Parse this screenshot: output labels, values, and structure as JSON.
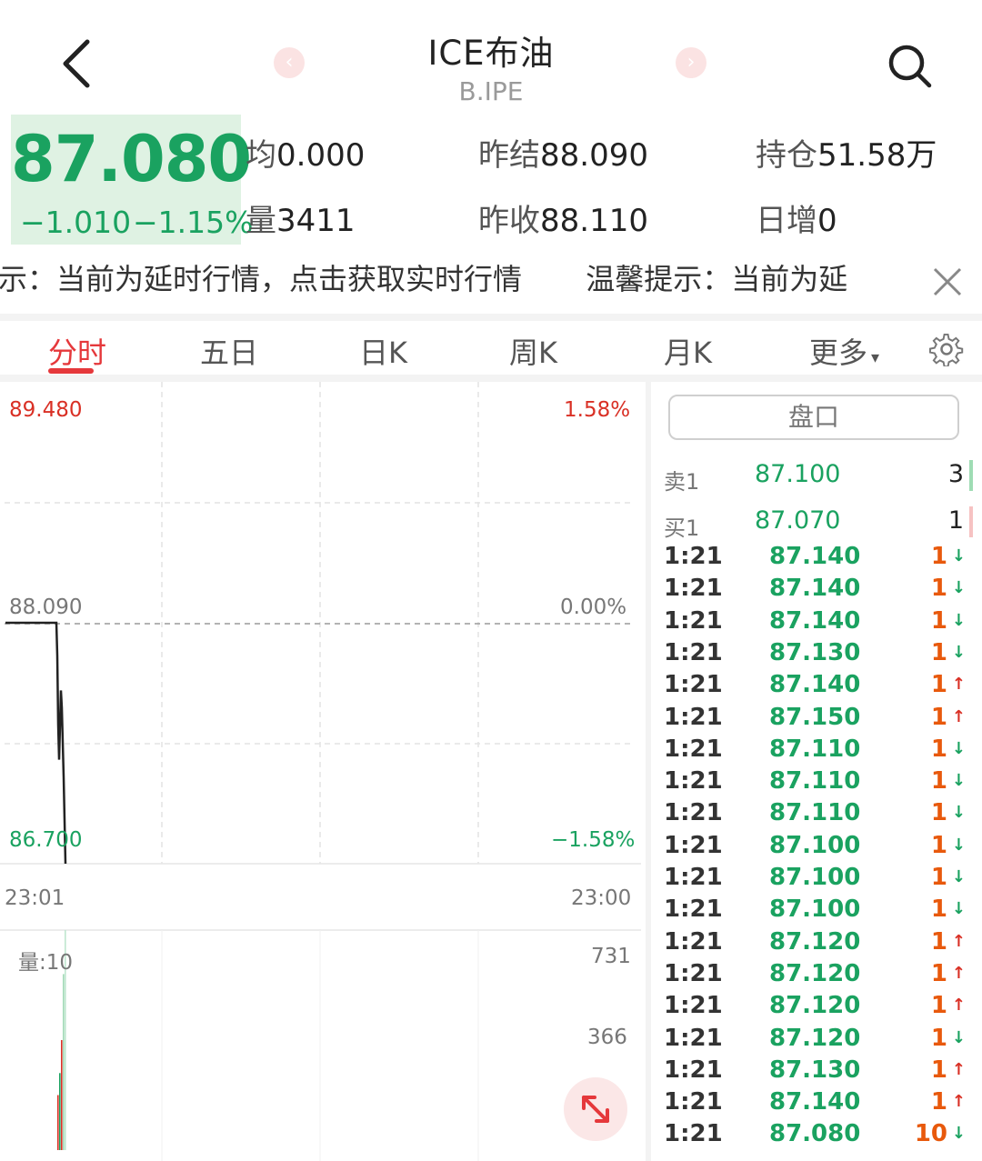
{
  "header": {
    "title": "ICE布油",
    "code": "B.IPE"
  },
  "quote": {
    "price": "87.080",
    "change": "−1.010",
    "change_pct": "−1.15%",
    "avg_label": "均",
    "avg_value": "0.000",
    "prev_settle_label": "昨结",
    "prev_settle_value": "88.090",
    "open_interest_label": "持仓",
    "open_interest_value": "51.58万",
    "volume_label": "量",
    "volume_value": "3411",
    "prev_close_label": "昨收",
    "prev_close_value": "88.110",
    "daily_increase_label": "日增",
    "daily_increase_value": "0"
  },
  "notice": {
    "text_1": "提示：当前为延时行情，点击获取实时行情",
    "text_2": "温馨提示：当前为延"
  },
  "tabs": [
    {
      "label": "分时",
      "active": true
    },
    {
      "label": "五日",
      "active": false
    },
    {
      "label": "日K",
      "active": false
    },
    {
      "label": "周K",
      "active": false
    },
    {
      "label": "月K",
      "active": false
    },
    {
      "label": "更多",
      "active": false
    }
  ],
  "chart": {
    "price_high": "89.480",
    "pct_high": "1.58%",
    "price_mid": "88.090",
    "pct_mid": "0.00%",
    "price_low": "86.700",
    "pct_low": "−1.58%",
    "time_start": "23:01",
    "time_end": "23:00",
    "volume_label": "量:10",
    "vol_max": "731",
    "vol_mid": "366"
  },
  "chart_data": {
    "type": "line",
    "title": "",
    "ylim": [
      86.7,
      89.48
    ],
    "reference_price": 88.09,
    "x_range": [
      "23:01",
      "23:00"
    ],
    "series": [
      {
        "values": [
          88.09,
          88.09,
          87.9,
          87.5,
          87.3,
          87.7,
          87.6,
          87.2,
          86.7
        ]
      }
    ],
    "volume_ylim": [
      0,
      731
    ],
    "grid": true,
    "colors": {
      "up": "#d93025",
      "down": "#1aa260",
      "line": "#222222"
    }
  },
  "orderbook": {
    "title": "盘口",
    "sell": {
      "label": "卖1",
      "price": "87.100",
      "volume": "3"
    },
    "buy": {
      "label": "买1",
      "price": "87.070",
      "volume": "1"
    }
  },
  "ticks": [
    {
      "time": "1:21",
      "price": "87.140",
      "vol": "1",
      "dir": "down"
    },
    {
      "time": "1:21",
      "price": "87.140",
      "vol": "1",
      "dir": "down"
    },
    {
      "time": "1:21",
      "price": "87.140",
      "vol": "1",
      "dir": "down"
    },
    {
      "time": "1:21",
      "price": "87.130",
      "vol": "1",
      "dir": "down"
    },
    {
      "time": "1:21",
      "price": "87.140",
      "vol": "1",
      "dir": "up"
    },
    {
      "time": "1:21",
      "price": "87.150",
      "vol": "1",
      "dir": "up"
    },
    {
      "time": "1:21",
      "price": "87.110",
      "vol": "1",
      "dir": "down"
    },
    {
      "time": "1:21",
      "price": "87.110",
      "vol": "1",
      "dir": "down"
    },
    {
      "time": "1:21",
      "price": "87.110",
      "vol": "1",
      "dir": "down"
    },
    {
      "time": "1:21",
      "price": "87.100",
      "vol": "1",
      "dir": "down"
    },
    {
      "time": "1:21",
      "price": "87.100",
      "vol": "1",
      "dir": "down"
    },
    {
      "time": "1:21",
      "price": "87.100",
      "vol": "1",
      "dir": "down"
    },
    {
      "time": "1:21",
      "price": "87.120",
      "vol": "1",
      "dir": "up"
    },
    {
      "time": "1:21",
      "price": "87.120",
      "vol": "1",
      "dir": "up"
    },
    {
      "time": "1:21",
      "price": "87.120",
      "vol": "1",
      "dir": "up"
    },
    {
      "time": "1:21",
      "price": "87.120",
      "vol": "1",
      "dir": "down"
    },
    {
      "time": "1:21",
      "price": "87.130",
      "vol": "1",
      "dir": "up"
    },
    {
      "time": "1:21",
      "price": "87.140",
      "vol": "1",
      "dir": "up"
    },
    {
      "time": "1:21",
      "price": "87.080",
      "vol": "10",
      "dir": "down"
    }
  ],
  "icons": {
    "back": "back-arrow-icon",
    "prev": "chevron-left-icon",
    "next": "chevron-right-icon",
    "search": "search-icon",
    "close": "close-icon",
    "settings": "gear-icon",
    "expand": "expand-icon"
  }
}
